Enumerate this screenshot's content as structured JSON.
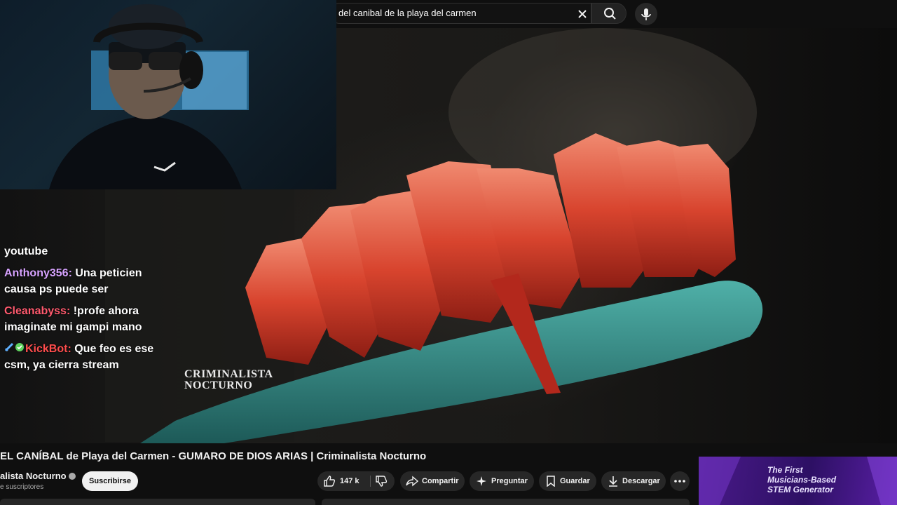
{
  "search": {
    "query": "del canibal de la playa del carmen"
  },
  "video": {
    "watermark_line1": "CRIMINALISTA",
    "watermark_line2": "NOCTURNO"
  },
  "chat": {
    "messages": [
      {
        "user": "",
        "text": "youtube"
      },
      {
        "user": "Anthony356:",
        "text": "Una peticien causa ps puede ser"
      },
      {
        "user": "Cleanabyss:",
        "text": "!profe ahora imaginate mi gampi mano"
      },
      {
        "user": "KickBot:",
        "text": "Que feo es ese csm, ya cierra stream"
      }
    ]
  },
  "title": "EL CANÍBAL de Playa del Carmen - GUMARO DE DIOS ARIAS | Criminalista Nocturno",
  "channel": {
    "name": "alista Nocturno",
    "subscribers": "e suscriptores",
    "subscribe_label": "Suscribirse"
  },
  "actions": {
    "likes": "147 k",
    "share": "Compartir",
    "ask": "Preguntar",
    "save": "Guardar",
    "download": "Descargar"
  },
  "ad": {
    "line1": "The First",
    "line2": "Musicians-Based",
    "line3": "STEM Generator"
  },
  "colors": {
    "background": "#0f0f0f",
    "pill": "#272727",
    "chat_anthony": "#d7a3ff",
    "chat_cleanabyss": "#ff5a6e",
    "chat_kickbot": "#ff4d4d"
  }
}
